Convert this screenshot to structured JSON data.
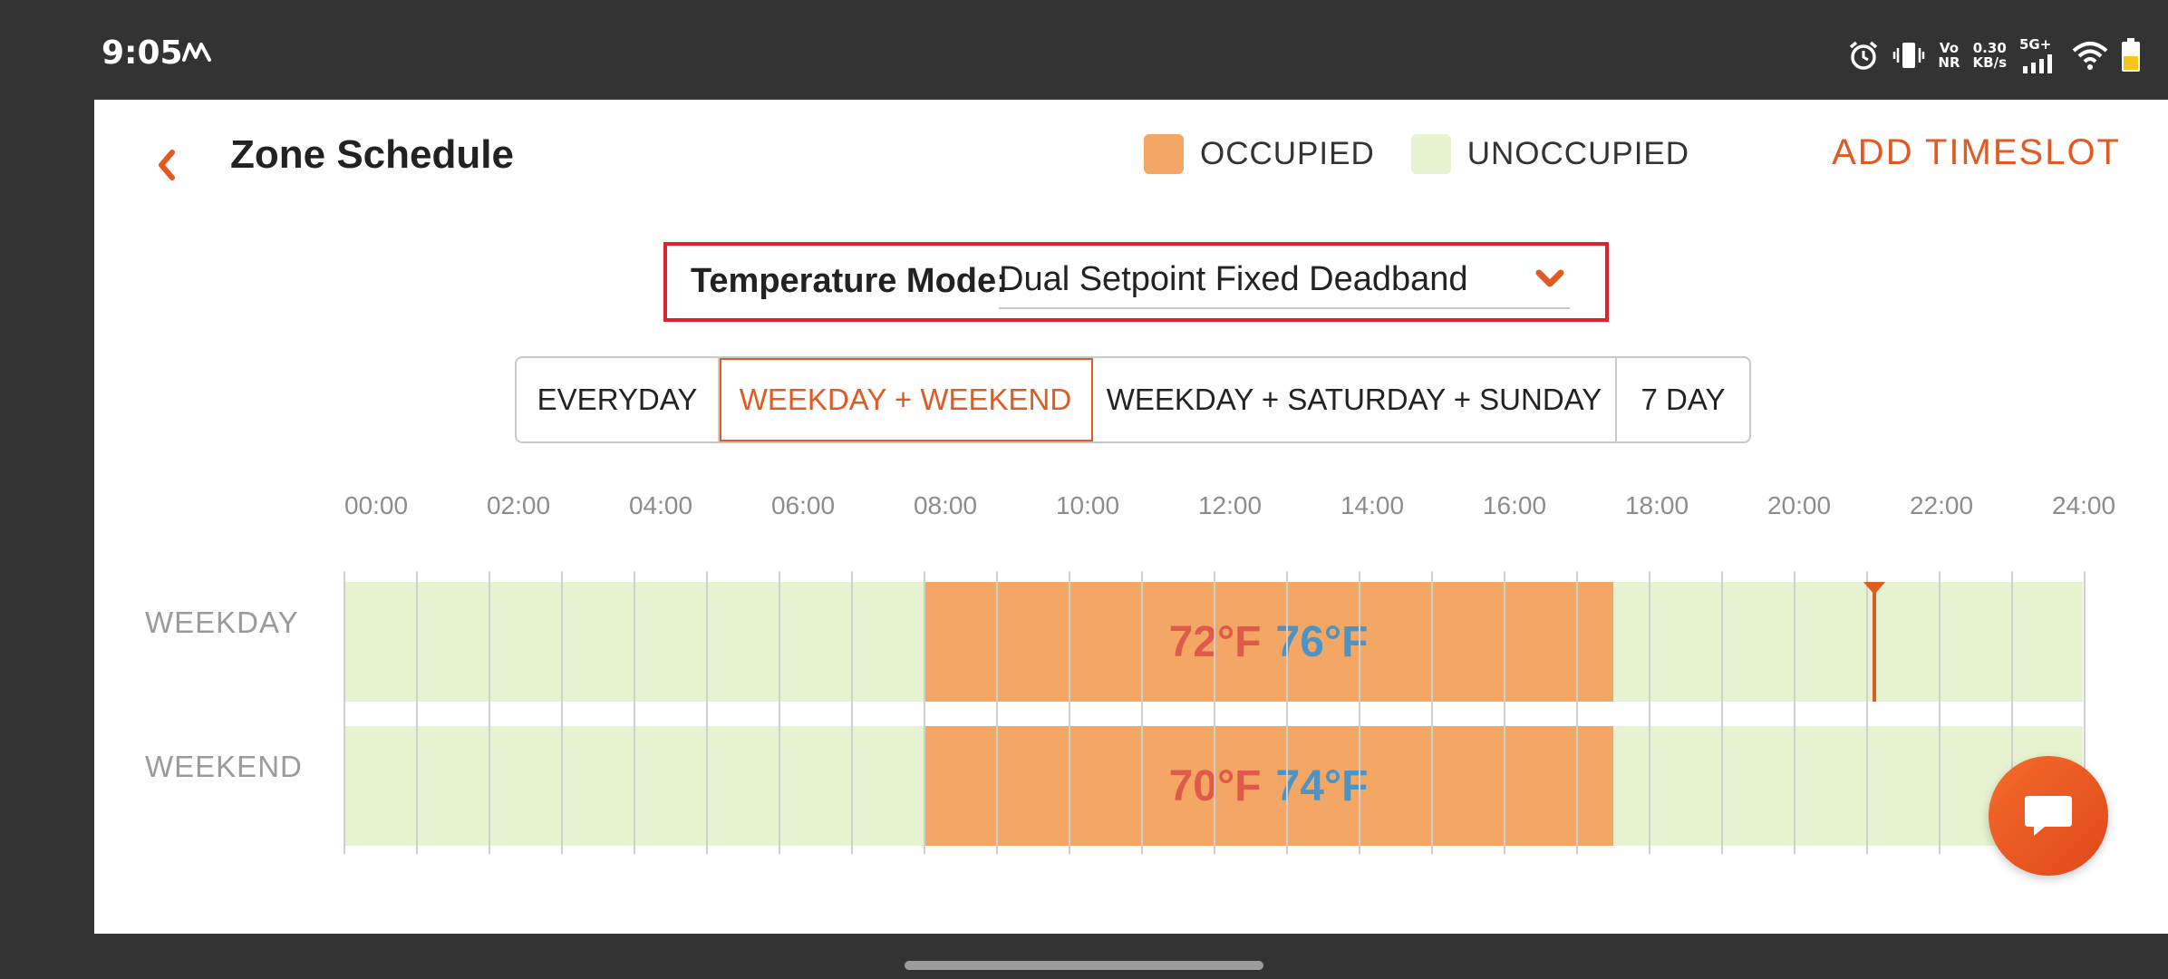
{
  "status_bar": {
    "time": "9:05",
    "carrier_icon": "m-logo-icon",
    "network_vo": "Vo",
    "network_nr": "NR",
    "speed_value": "0.30",
    "speed_unit": "KB/s",
    "signal_type": "5G+",
    "icons": [
      "alarm-icon",
      "vibrate-icon",
      "signal-icon",
      "wifi-icon",
      "battery-icon"
    ]
  },
  "header": {
    "title": "Zone Schedule",
    "back_icon": "chevron-left-icon",
    "add_button": "ADD TIMESLOT"
  },
  "legend": [
    {
      "label": "OCCUPIED",
      "color": "#f4a765"
    },
    {
      "label": "UNOCCUPIED",
      "color": "#e7f2d0"
    }
  ],
  "temperature_mode": {
    "label": "Temperature Mode:",
    "value": "Dual Setpoint Fixed Deadband"
  },
  "schedule_tabs": [
    {
      "label": "EVERYDAY",
      "active": false
    },
    {
      "label": "WEEKDAY + WEEKEND",
      "active": true
    },
    {
      "label": "WEEKDAY + SATURDAY + SUNDAY",
      "active": false
    },
    {
      "label": "7 DAY",
      "active": false
    }
  ],
  "timeline": {
    "hour_labels": [
      "00:00",
      "02:00",
      "04:00",
      "06:00",
      "08:00",
      "10:00",
      "12:00",
      "14:00",
      "16:00",
      "18:00",
      "20:00",
      "22:00",
      "24:00"
    ],
    "current_time_hours": 21.1,
    "rows": [
      {
        "label": "WEEKDAY",
        "occupied_start": "08:00",
        "occupied_end": "17:30",
        "heat_setpoint": "72°F",
        "cool_setpoint": "76°F"
      },
      {
        "label": "WEEKEND",
        "occupied_start": "08:00",
        "occupied_end": "17:30",
        "heat_setpoint": "70°F",
        "cool_setpoint": "74°F"
      }
    ]
  },
  "colors": {
    "accent": "#e05a22",
    "occupied": "#f4a765",
    "unoccupied": "#e7f2d0",
    "heat_text": "#e1594a",
    "cool_text": "#4d94c6",
    "highlight_border": "#e0212e"
  },
  "chat_button_icon": "chat-bubble-icon"
}
